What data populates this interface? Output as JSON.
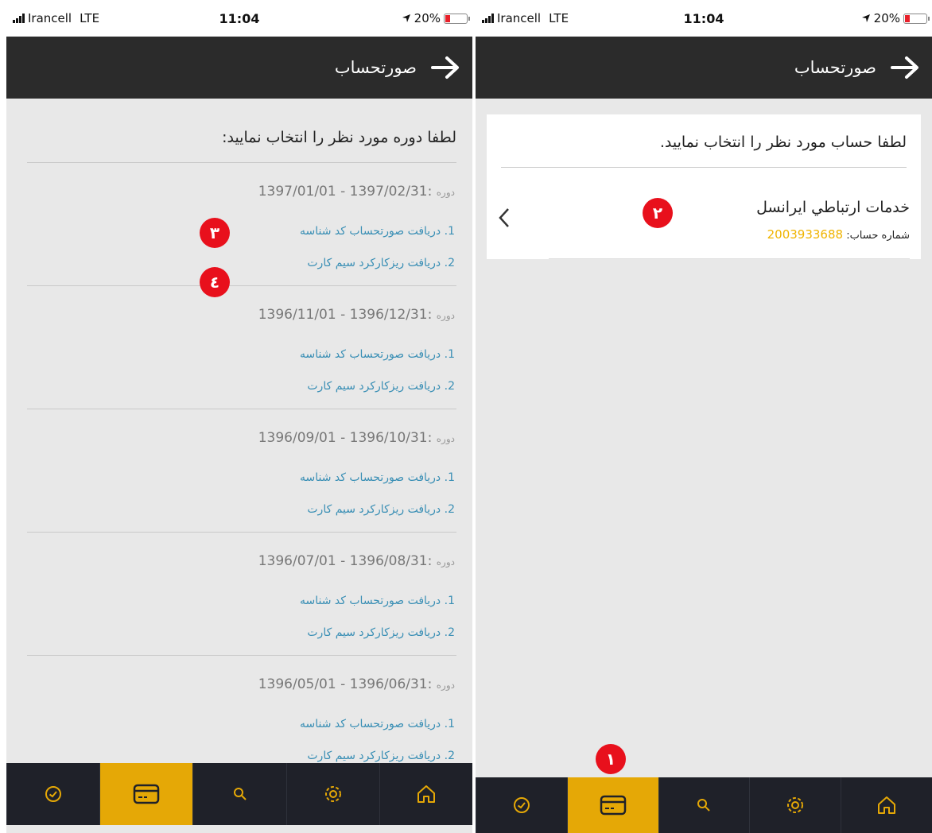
{
  "left": {
    "status": {
      "carrier": "Irancell",
      "network": "LTE",
      "time": "11:04",
      "battery": "20%"
    },
    "app_bar": {
      "title": "صورتحساب"
    },
    "prompt": "لطفا دوره مورد نظر را انتخاب نمایید:",
    "period_label": "دوره",
    "periods": [
      {
        "range": "1397/02/31 - 1397/01/01"
      },
      {
        "range": "1396/12/31 - 1396/11/01"
      },
      {
        "range": "1396/10/31 - 1396/09/01"
      },
      {
        "range": "1396/08/31 - 1396/07/01"
      },
      {
        "range": "1396/06/31 - 1396/05/01"
      }
    ],
    "link1": "1. دریافت صورتحساب کد شناسه",
    "link2": "2. دریافت ریزکارکرد سیم کارت",
    "badges": {
      "three": "٣",
      "four": "٤"
    }
  },
  "right": {
    "status": {
      "carrier": "Irancell",
      "network": "LTE",
      "time": "11:04",
      "battery": "20%"
    },
    "app_bar": {
      "title": "صورتحساب"
    },
    "prompt": "لطفا حساب مورد نظر را انتخاب نمایید.",
    "account": {
      "name": "خدمات ارتباطي ايرانسل",
      "number_label": "شماره حساب:",
      "number": "2003933688"
    },
    "badges": {
      "one": "١",
      "two": "٢"
    }
  },
  "colors": {
    "accent": "#e5a806",
    "link": "#3a8fb5",
    "badge": "#e8101c",
    "number": "#f0b400",
    "header": "#2b2b2b",
    "nav": "#1f2129"
  },
  "nav_icons": [
    "clock-icon",
    "card-icon",
    "search-icon",
    "gear-icon",
    "home-icon"
  ]
}
